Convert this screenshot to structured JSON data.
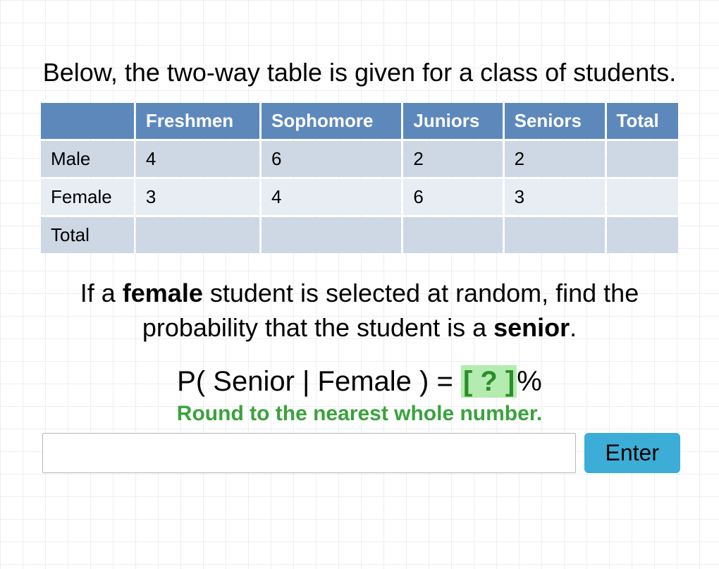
{
  "intro": "Below, the two-way table is given for a class of students.",
  "table": {
    "headers": [
      "",
      "Freshmen",
      "Sophomore",
      "Juniors",
      "Seniors",
      "Total"
    ],
    "rows": [
      {
        "label": "Male",
        "cells": [
          "4",
          "6",
          "2",
          "2",
          ""
        ]
      },
      {
        "label": "Female",
        "cells": [
          "3",
          "4",
          "6",
          "3",
          ""
        ]
      },
      {
        "label": "Total",
        "cells": [
          "",
          "",
          "",
          "",
          ""
        ]
      }
    ]
  },
  "question": {
    "part1": "If a ",
    "bold1": "female",
    "part2": " student is selected at random, find the probability that the student is a ",
    "bold2": "senior",
    "part3": "."
  },
  "formula": {
    "prefix": "P( Senior | Female ) = ",
    "slot": "[ ? ]",
    "suffix": "%"
  },
  "roundNote": "Round to the nearest whole number.",
  "input": {
    "value": "",
    "placeholder": ""
  },
  "enterLabel": "Enter",
  "chart_data": {
    "type": "table",
    "title": "Two-way table for a class of students",
    "columns": [
      "Freshmen",
      "Sophomore",
      "Juniors",
      "Seniors",
      "Total"
    ],
    "rows": [
      "Male",
      "Female",
      "Total"
    ],
    "values": [
      [
        4,
        6,
        2,
        2,
        null
      ],
      [
        3,
        4,
        6,
        3,
        null
      ],
      [
        null,
        null,
        null,
        null,
        null
      ]
    ]
  }
}
